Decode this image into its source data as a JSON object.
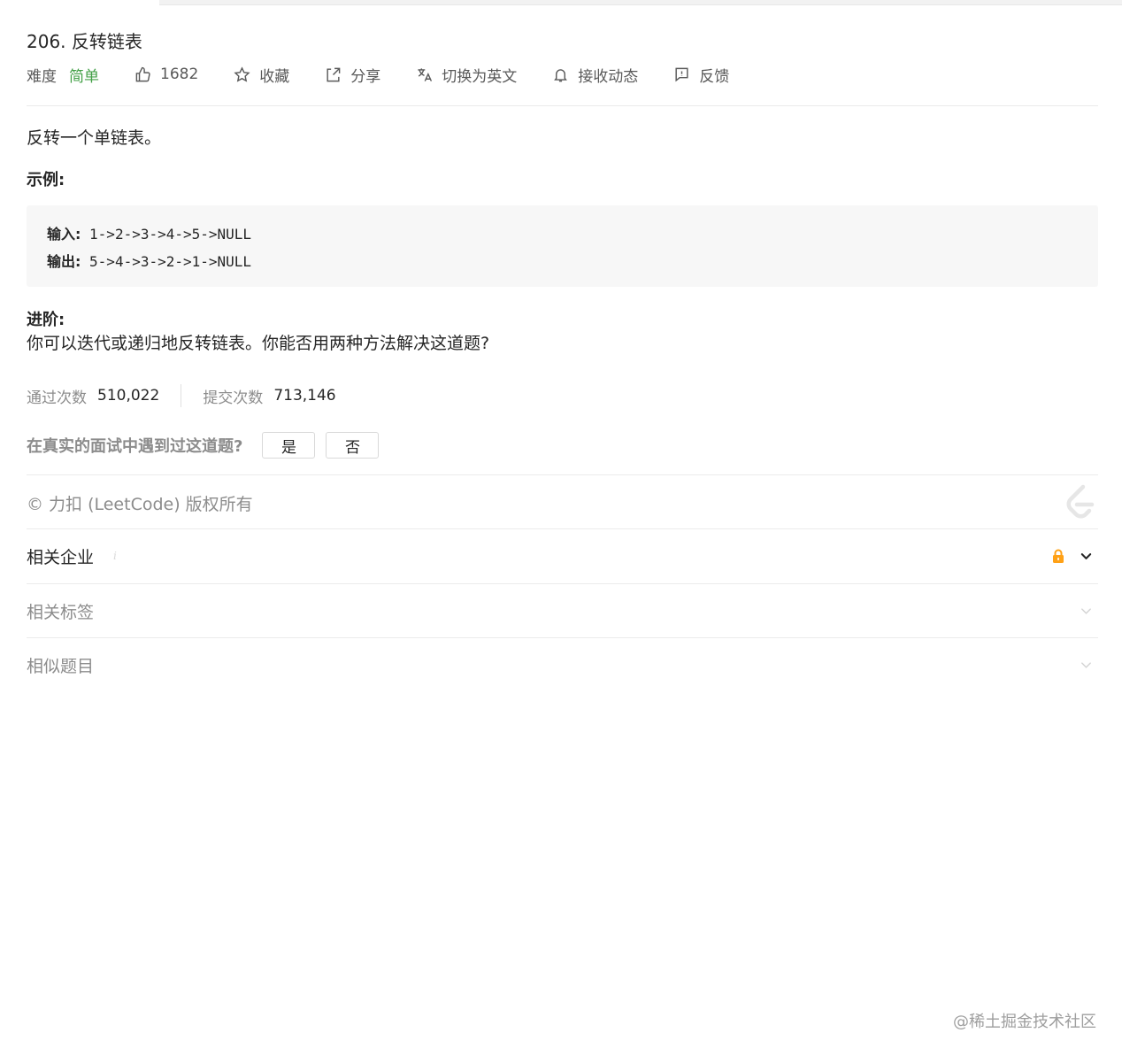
{
  "problem": {
    "title": "206. 反转链表",
    "difficulty_label": "难度",
    "difficulty": "简单",
    "likes": "1682",
    "favorite": "收藏",
    "share": "分享",
    "switch_lang": "切换为英文",
    "subscribe": "接收动态",
    "feedback": "反馈"
  },
  "description": {
    "text": "反转一个单链表。",
    "example_label": "示例:",
    "input_key": "输入:",
    "input_value": " 1->2->3->4->5->NULL",
    "output_key": "输出:",
    "output_value": " 5->4->3->2->1->NULL",
    "advanced_label": "进阶:",
    "advanced_text": "你可以迭代或递归地反转链表。你能否用两种方法解决这道题?"
  },
  "stats": {
    "accepted_label": "通过次数",
    "accepted_value": "510,022",
    "submissions_label": "提交次数",
    "submissions_value": "713,146"
  },
  "interview": {
    "question": "在真实的面试中遇到过这道题?",
    "yes": "是",
    "no": "否"
  },
  "footer": {
    "copyright": "© 力扣 (LeetCode) 版权所有"
  },
  "sections": {
    "companies": "相关企业",
    "companies_info": "i",
    "tags": "相关标签",
    "similar": "相似题目"
  },
  "watermark": "@稀土掘金技术社区",
  "colors": {
    "easy": "#43a047",
    "lock": "#ffa116"
  }
}
